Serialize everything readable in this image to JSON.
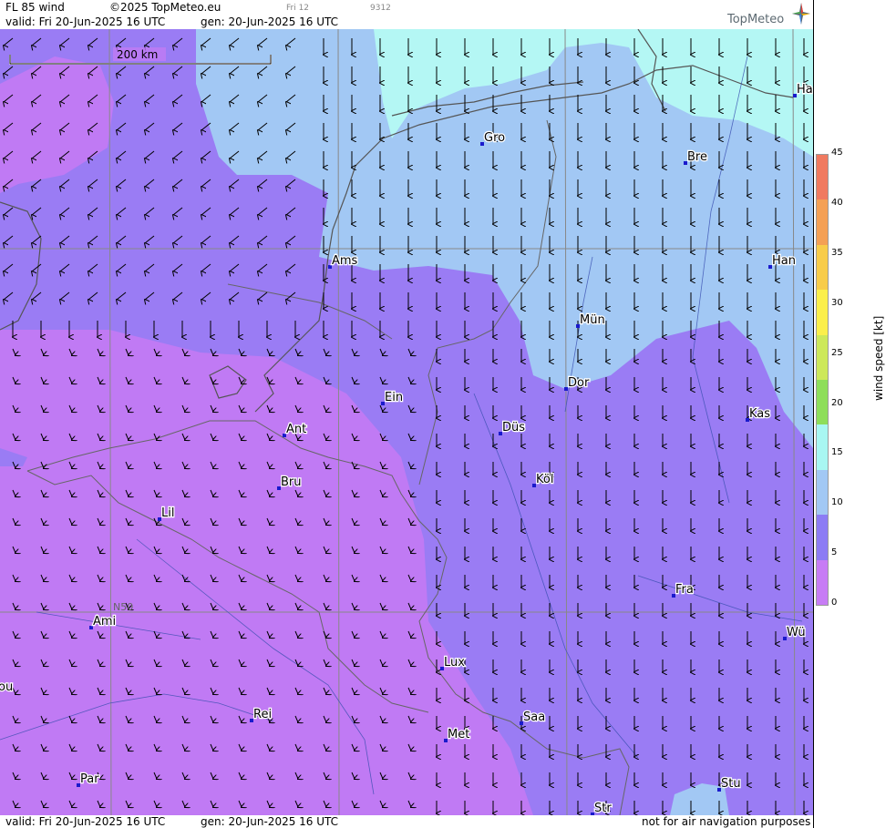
{
  "header": {
    "title": "FL 85 wind",
    "copyright": "©2025 TopMeteo.eu",
    "day_small": "Fri 12",
    "code_small": "9312",
    "valid": "valid:  Fri  20-Jun-2025  16 UTC",
    "gen": "gen: 20-Jun-2025 16 UTC",
    "logo": "TopMeteo"
  },
  "footer": {
    "valid": "valid:  Fri  20-Jun-2025  16 UTC",
    "gen": "gen: 20-Jun-2025 16 UTC",
    "disclaimer": "not for air navigation purposes"
  },
  "map": {
    "scale_label": "200 km",
    "lat_label": "N50",
    "cities": [
      "Ha",
      "Gro",
      "Bre",
      "Ams",
      "Han",
      "Mün",
      "Ein",
      "Dor",
      "Düs",
      "Kas",
      "Ant",
      "Köl",
      "Bru",
      "Lil",
      "Fra",
      "Ami",
      "Wü",
      "Lux",
      "ou",
      "Rei",
      "Saa",
      "Met",
      "Par",
      "Stu",
      "Str"
    ],
    "wind_direction": "north to south"
  },
  "legend": {
    "label": "wind speed [kt]",
    "ticks": [
      "45",
      "40",
      "35",
      "30",
      "25",
      "20",
      "15",
      "10",
      "5",
      "0"
    ],
    "colors": [
      "#f07a60",
      "#f4a055",
      "#f8cc4a",
      "#fbef4b",
      "#cde85a",
      "#8ede5a",
      "#a8f7f2",
      "#a2c8f4",
      "#8c7cf4",
      "#c77cf5"
    ]
  },
  "colors": {
    "purple_light": "#c07af4",
    "purple_dark": "#9a7cf4",
    "blue": "#a2c8f4",
    "cyan": "#b4f7f4"
  }
}
